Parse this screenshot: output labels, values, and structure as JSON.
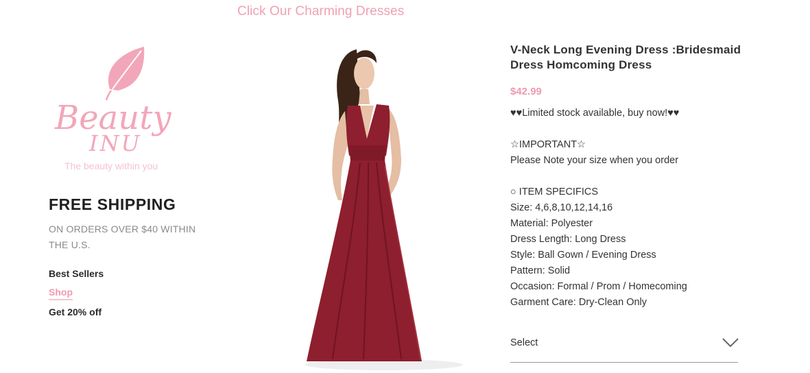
{
  "top_link": "Click Our Charming Dresses",
  "logo": {
    "brand_line1": "Beauty",
    "brand_line2": "INU",
    "tagline": "The beauty within you",
    "color": "#f2a6b9"
  },
  "sidebar": {
    "free_shipping_title": "FREE SHIPPING",
    "free_shipping_sub": "ON ORDERS OVER $40 WITHIN THE U.S.",
    "links": [
      "Best Sellers",
      "Shop",
      "Get 20% off"
    ]
  },
  "product": {
    "title": "V-Neck Long Evening Dress :Bridesmaid Dress Homcoming Dress",
    "price": "$42.99",
    "stock_note": "♥♥Limited stock available, buy now!♥♥",
    "important_label": "☆IMPORTANT☆",
    "important_note": "Please Note your size when you order",
    "specifics_heading": "○ ITEM SPECIFICS",
    "specifics": [
      "Size: 4,6,8,10,12,14,16",
      "Material: Polyester",
      "Dress Length: Long Dress",
      "Style: Ball Gown / Evening Dress",
      "Pattern: Solid",
      "Occasion: Formal / Prom / Homecoming",
      "Garment Care: Dry-Clean Only"
    ],
    "select_label": "Select"
  },
  "colors": {
    "accent_pink": "#f09ab0",
    "dress": "#8e1f2e"
  }
}
